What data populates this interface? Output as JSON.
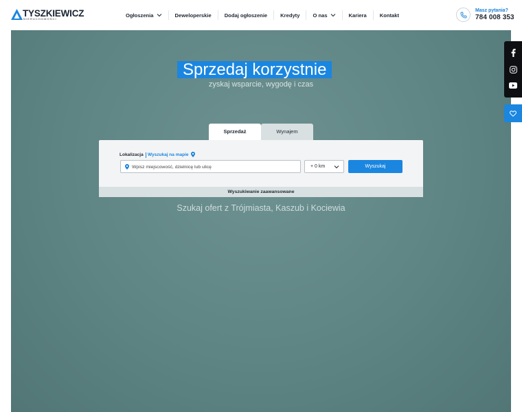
{
  "brand": {
    "name": "TYSZKIEWICZ",
    "tagline": "NIERUCHOMOŚCI"
  },
  "nav": [
    {
      "label": "Ogłoszenia",
      "dropdown": true
    },
    {
      "label": "Deweloperskie",
      "dropdown": false
    },
    {
      "label": "Dodaj ogłoszenie",
      "dropdown": false
    },
    {
      "label": "Kredyty",
      "dropdown": false
    },
    {
      "label": "O nas",
      "dropdown": true
    },
    {
      "label": "Kariera",
      "dropdown": false
    },
    {
      "label": "Kontakt",
      "dropdown": false
    }
  ],
  "contact": {
    "question": "Masz pytania?",
    "phone": "784 008 353"
  },
  "hero": {
    "title": "Sprzedaj korzystnie",
    "subtitle": "zyskaj wsparcie, wygodę i czas",
    "bottom_text": "Szukaj ofert z Trójmiasta, Kaszub i Kociewia"
  },
  "search": {
    "tabs": [
      {
        "label": "Sprzedaż",
        "active": true
      },
      {
        "label": "Wynajem",
        "active": false
      }
    ],
    "location_label": "Lokalizacja",
    "map_link": "Wyszukaj na mapie",
    "location_placeholder": "Wpisz miejscowość, dzielnicę lub ulicę",
    "distance_value": "+ 0 km",
    "submit_label": "Wyszukaj",
    "advanced_label": "Wyszukiwanie zaawansowane"
  },
  "social": [
    "facebook-icon",
    "instagram-icon",
    "youtube-icon"
  ],
  "colors": {
    "accent": "#1a86e0",
    "hero": "#5e8484",
    "dark": "#1f2733"
  }
}
